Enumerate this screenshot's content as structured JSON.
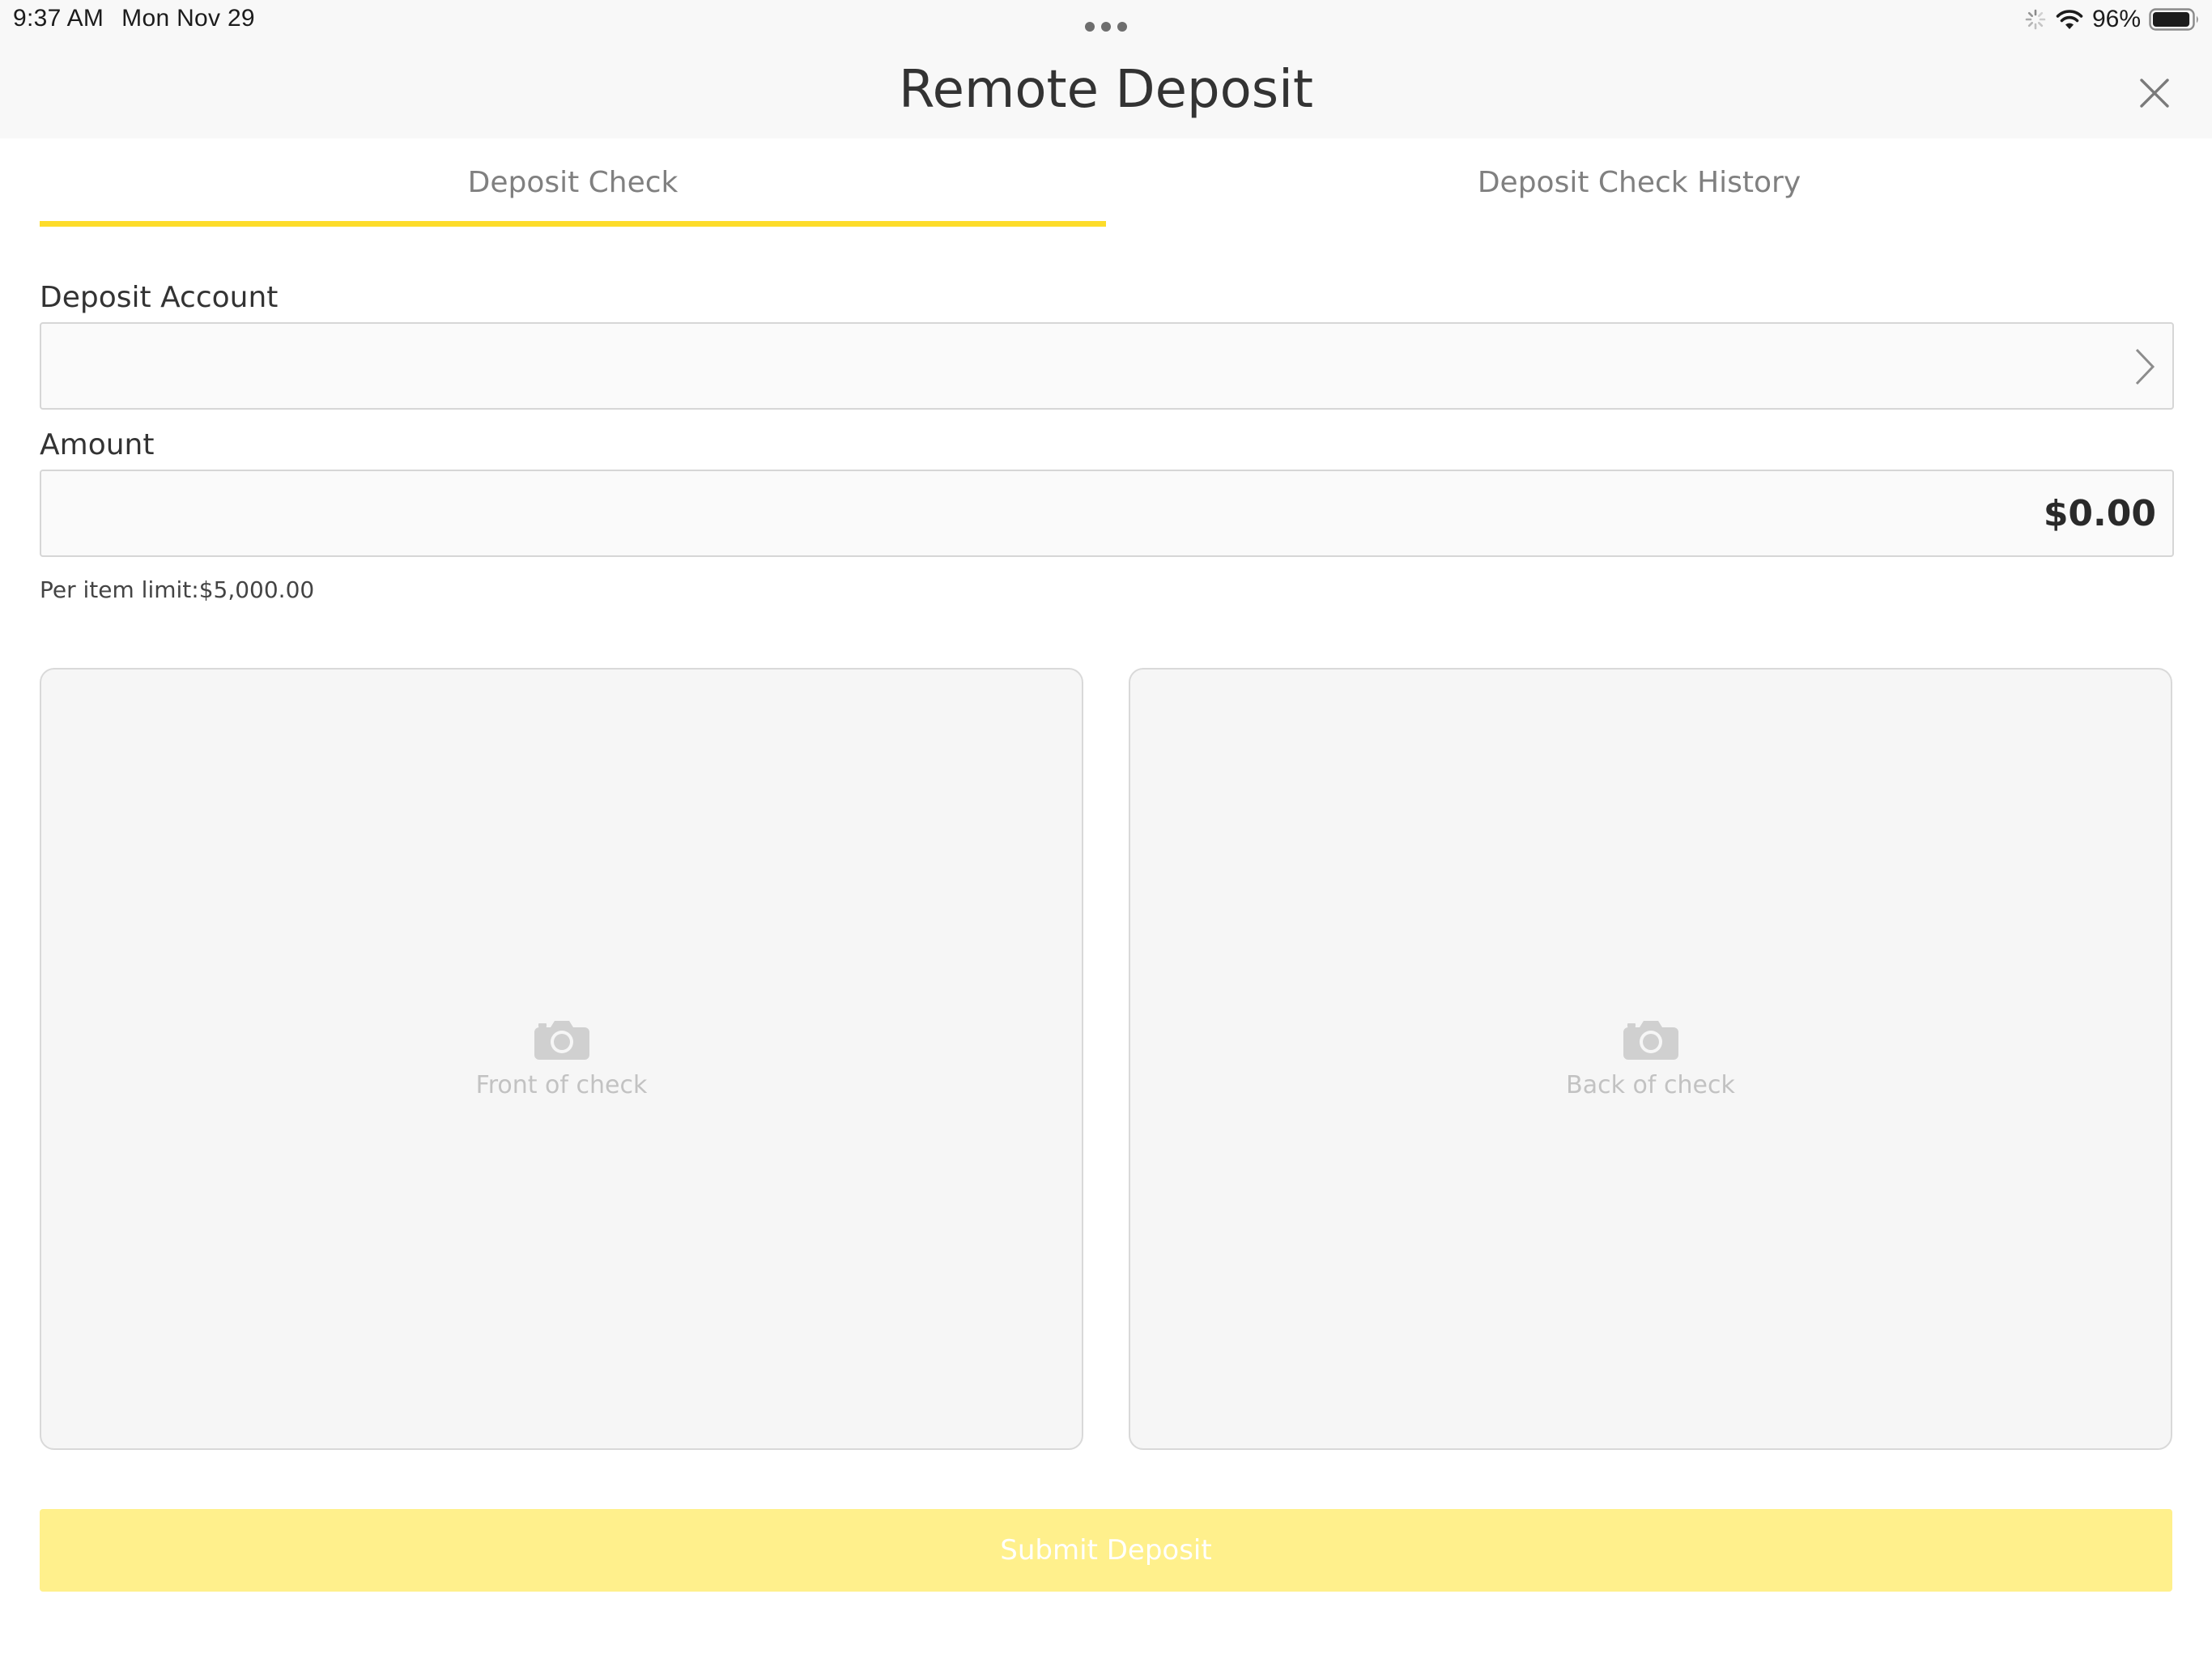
{
  "status_bar": {
    "time": "9:37 AM",
    "date": "Mon Nov 29",
    "battery_percent": "96%",
    "battery_level": 0.96
  },
  "nav": {
    "title": "Remote Deposit"
  },
  "tabs": [
    {
      "label": "Deposit Check",
      "active": true
    },
    {
      "label": "Deposit Check History",
      "active": false
    }
  ],
  "form": {
    "deposit_account": {
      "label": "Deposit Account",
      "value": ""
    },
    "amount": {
      "label": "Amount",
      "placeholder": "$0.00",
      "limit_text": "Per item limit:$5,000.00"
    }
  },
  "check_images": {
    "front_label": "Front of check",
    "back_label": "Back of check"
  },
  "submit": {
    "label": "Submit Deposit"
  },
  "colors": {
    "accent": "#fddc2a",
    "submit_disabled": "#fff08c"
  }
}
